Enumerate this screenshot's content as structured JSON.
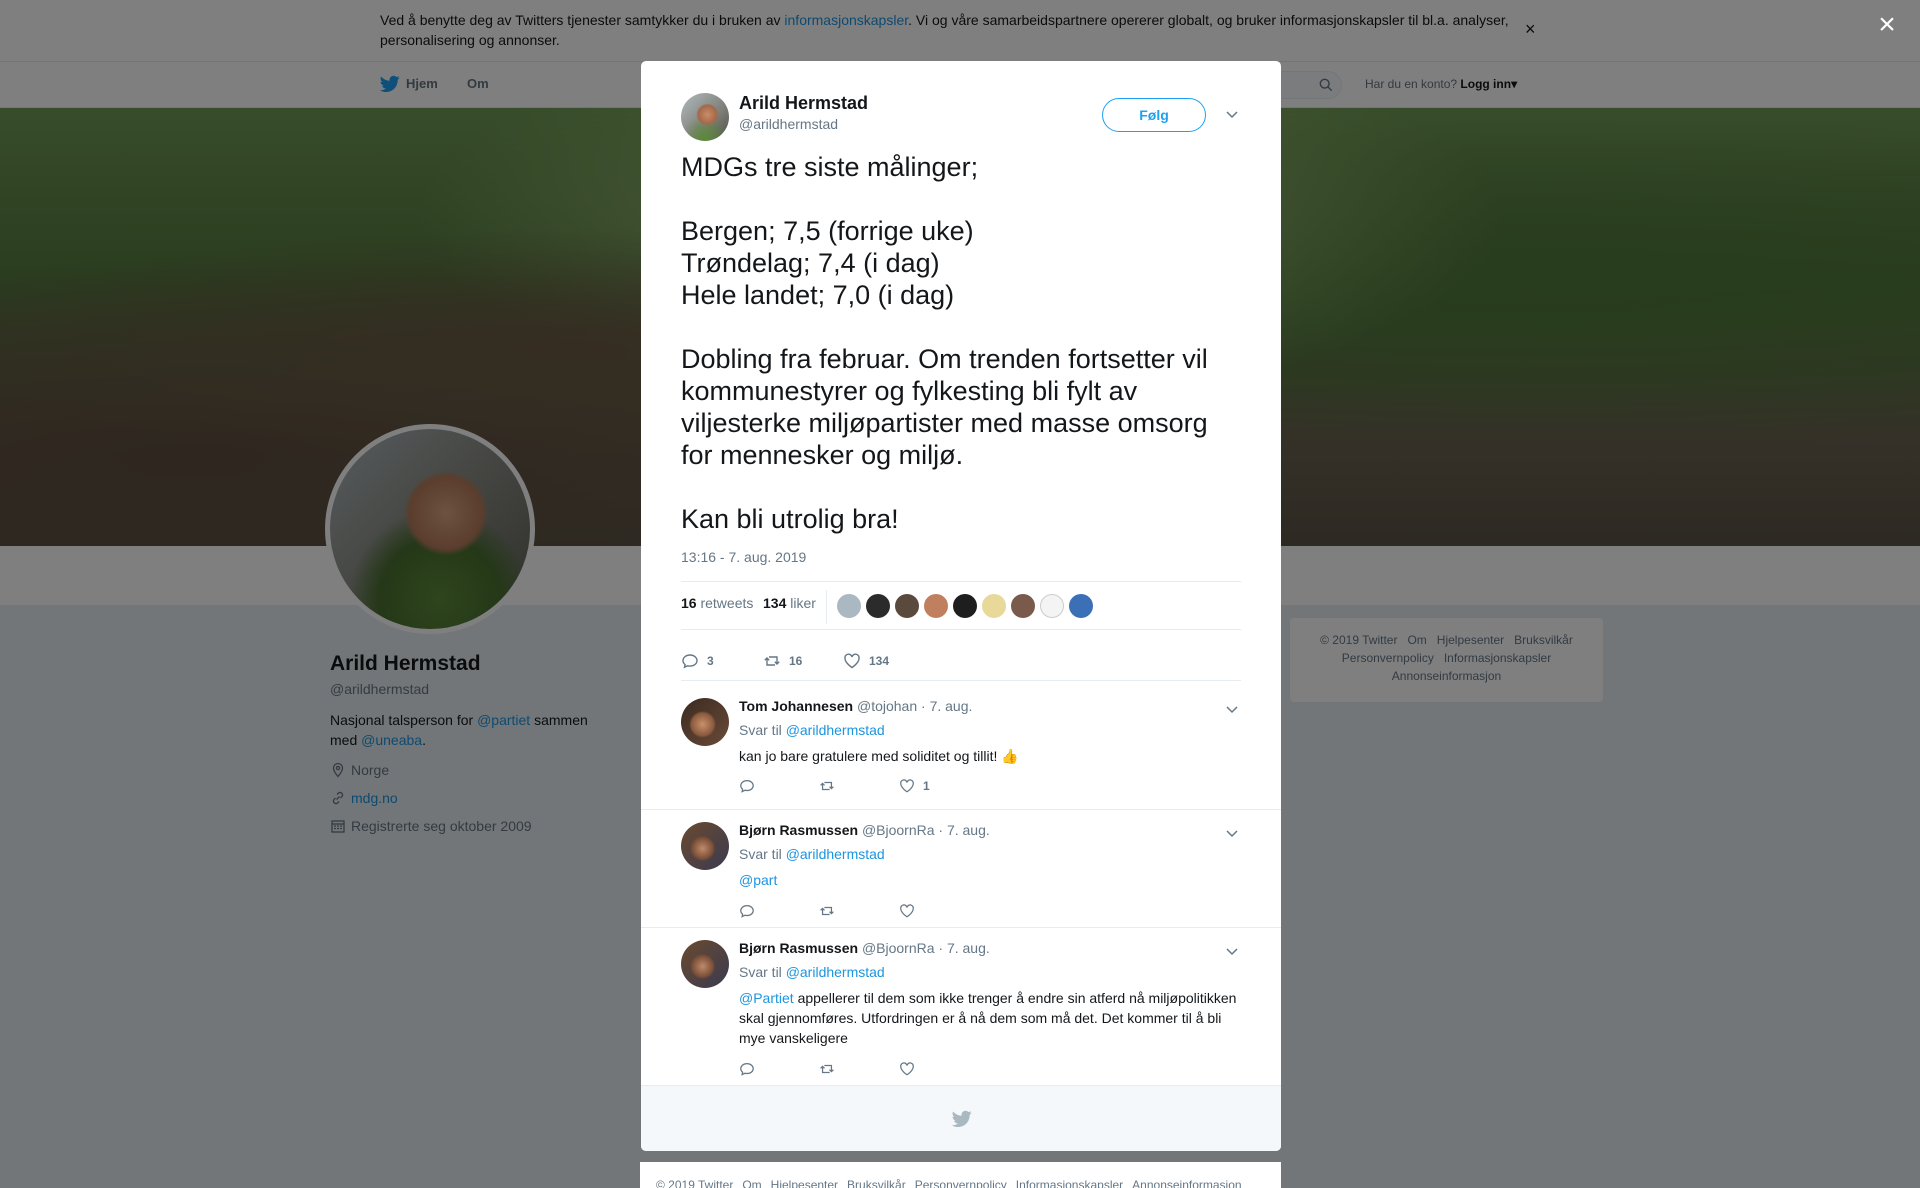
{
  "cookie_banner": {
    "text_before": "Ved å benytte deg av Twitters tjenester samtykker du i bruken av ",
    "link": "informasjonskapsler",
    "text_after": ". Vi og våre samarbeidspartnere opererer globalt, og bruker informasjonskapsler til bl.a. analyser, personalisering og annonser.",
    "close": "×"
  },
  "nav": {
    "home": "Hjem",
    "about": "Om",
    "account_prompt": "Har du en konto?",
    "login": "Logg inn",
    "login_caret": "▾"
  },
  "profile": {
    "name": "Arild Hermstad",
    "handle": "@arildhermstad",
    "bio_prefix": "Nasjonal talsperson for ",
    "bio_link1": "@partiet",
    "bio_middle": " sammen med ",
    "bio_link2": "@uneaba",
    "bio_suffix": ".",
    "location": "Norge",
    "website": "mdg.no",
    "joined": "Registrerte seg oktober 2009"
  },
  "side_footer": {
    "items": [
      "© 2019 Twitter",
      "Om",
      "Hjelpesenter",
      "Bruksvilkår",
      "Personvernpolicy",
      "Informasjonskapsler",
      "Annonseinformasjon"
    ]
  },
  "overlay_close": "×",
  "tweet": {
    "author_name": "Arild Hermstad",
    "author_handle": "@arildhermstad",
    "follow_label": "Følg",
    "text": "MDGs tre siste målinger;\n\nBergen; 7,5 (forrige uke)\nTrøndelag; 7,4 (i dag)\nHele landet; 7,0 (i dag)\n\nDobling fra februar. Om trenden fortsetter vil kommunestyrer og fylkesting bli fylt av viljesterke miljøpartister med masse omsorg for mennesker og miljø.\n\nKan bli utrolig bra!",
    "timestamp": "13:16 - 7. aug. 2019",
    "retweets_count": "16",
    "retweets_label": "retweets",
    "likes_count": "134",
    "likes_label": "liker",
    "actions": {
      "replies": "3",
      "retweets": "16",
      "likes": "134"
    }
  },
  "replies": [
    {
      "name": "Tom Johannesen",
      "handle": "@tojohan",
      "date": "· 7. aug.",
      "reply_to_label": "Svar til",
      "reply_to": "@arildhermstad",
      "text": "kan jo bare gratulere med soliditet og tillit!",
      "emoji": "👍",
      "likes": "1"
    },
    {
      "name": "Bjørn Rasmussen",
      "handle": "@BjoornRa",
      "date": "· 7. aug.",
      "reply_to_label": "Svar til",
      "reply_to": "@arildhermstad",
      "mention": "@part",
      "text": "",
      "likes": ""
    },
    {
      "name": "Bjørn Rasmussen",
      "handle": "@BjoornRa",
      "date": "· 7. aug.",
      "reply_to_label": "Svar til",
      "reply_to": "@arildhermstad",
      "mention": "@Partiet",
      "text": " appellerer til dem som ikke trenger å endre sin atferd nå miljøpolitikken skal gjennomføres. Utfordringen er å nå dem som må det. Det kommer til å bli mye vanskeligere",
      "likes": ""
    }
  ],
  "bottom_footer": {
    "items": [
      "© 2019 Twitter",
      "Om",
      "Hjelpesenter",
      "Bruksvilkår",
      "Personvernpolicy",
      "Informasjonskapsler",
      "Annonseinformasjon"
    ]
  },
  "colors": {
    "accent": "#1da1f2",
    "link": "#1b95e0",
    "muted": "#657786",
    "text": "#14171a",
    "overlay": "#6f7475"
  },
  "icons": {
    "nav_logo": "twitter-bird-icon",
    "search": "search-icon",
    "location": "location-pin-icon",
    "website": "link-icon",
    "joined": "calendar-icon",
    "reply": "reply-icon",
    "retweet": "retweet-icon",
    "like": "heart-icon",
    "more": "chevron-down-icon",
    "close": "close-icon"
  }
}
